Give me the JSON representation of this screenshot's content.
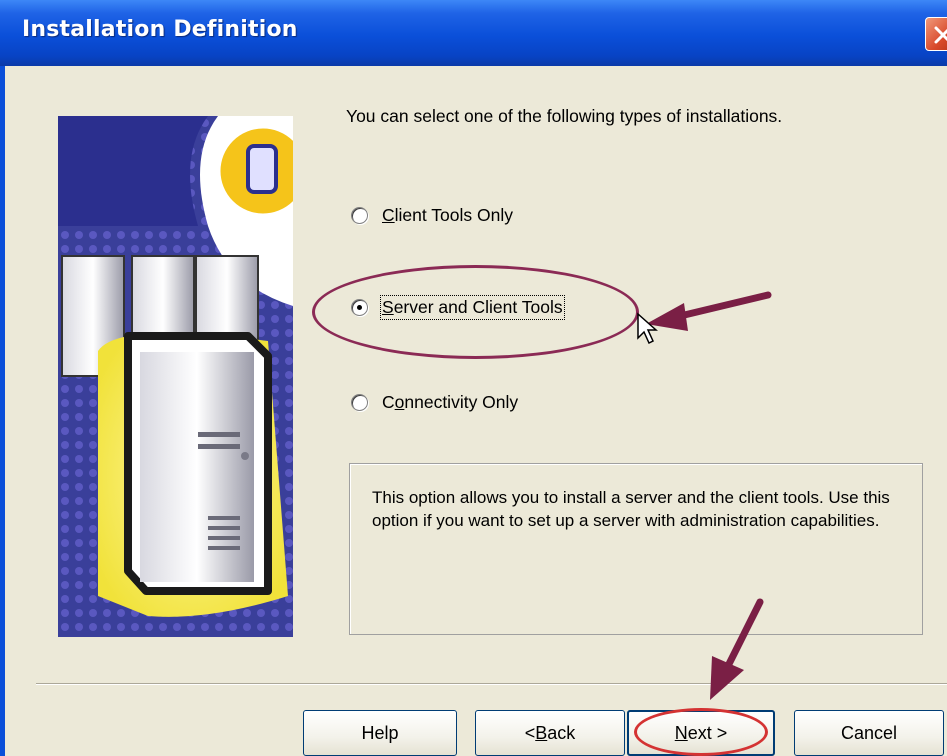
{
  "window": {
    "title": "Installation Definition"
  },
  "intro_text": "You can select one of the following types of installations.",
  "options": [
    {
      "label_pre": "",
      "label_key": "C",
      "label_post": "lient Tools Only",
      "checked": false
    },
    {
      "label_pre": "",
      "label_key": "S",
      "label_post": "erver and Client Tools",
      "checked": true
    },
    {
      "label_pre": "C",
      "label_key": "o",
      "label_post": "nnectivity Only",
      "checked": false
    }
  ],
  "description": "This option allows you to install a server and the client tools. Use this option if you want to set up a server with administration capabilities.",
  "buttons": {
    "help": "Help",
    "back_pre": "< ",
    "back_key": "B",
    "back_post": "ack",
    "next_key": "N",
    "next_post": "ext >",
    "cancel": "Cancel"
  },
  "annotations": {
    "arrow_color": "#7a1f45",
    "ellipse_color": "#8b2a55",
    "next_ellipse_color": "#d43333"
  },
  "icons": [
    "close-icon",
    "server-illustration",
    "mouse-cursor-icon",
    "annotation-arrow"
  ]
}
